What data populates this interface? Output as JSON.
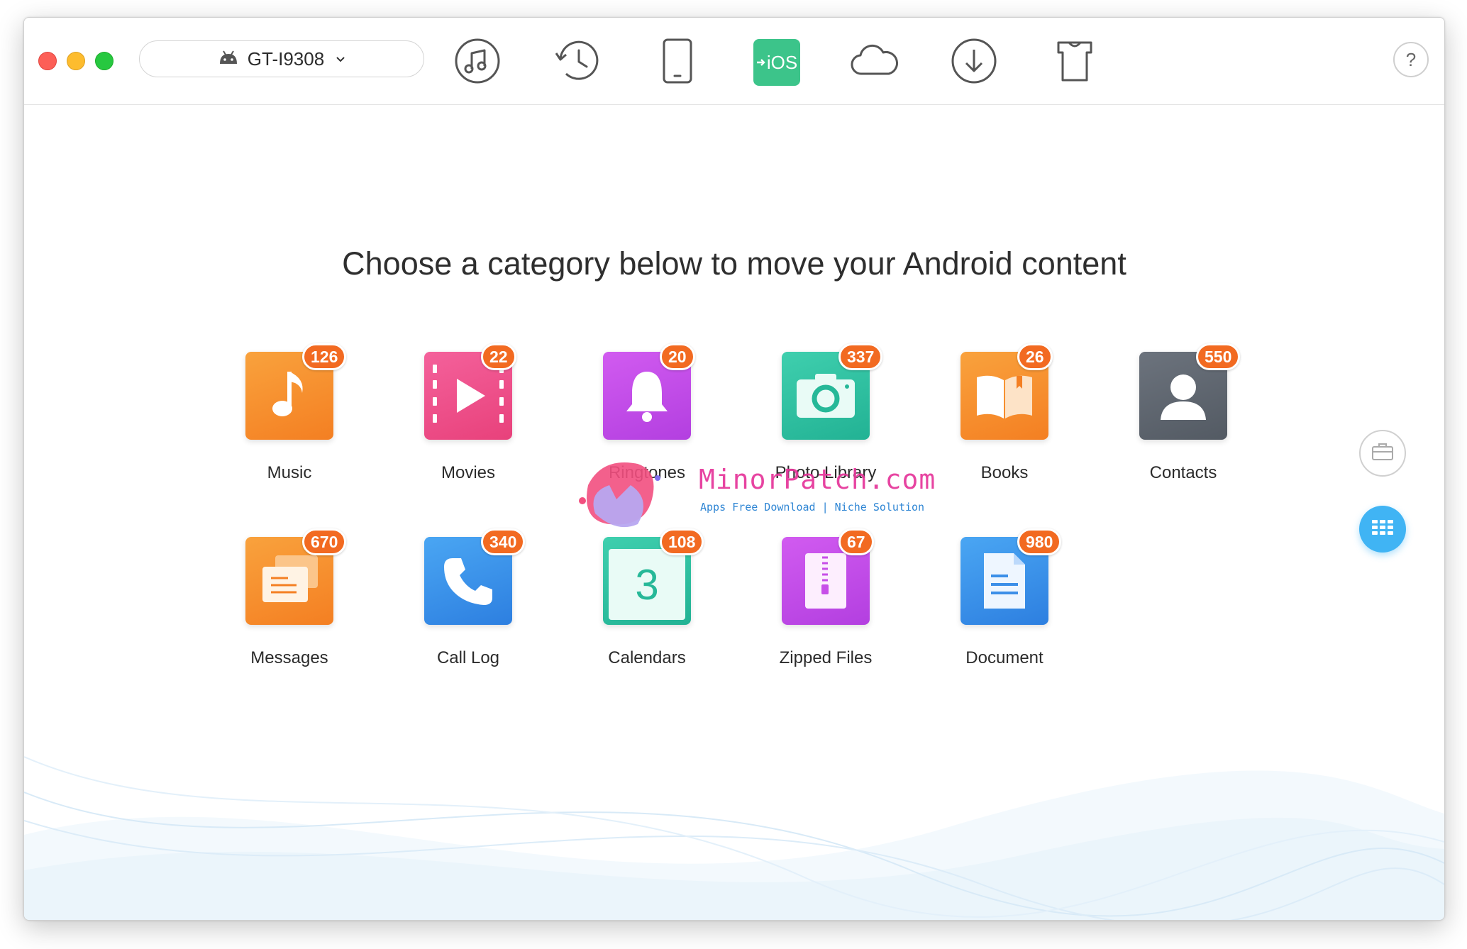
{
  "device": {
    "name": "GT-I9308",
    "icon": "android-icon"
  },
  "toolbar": {
    "items": [
      {
        "name": "music-manager-tool",
        "icon": "music-note-icon"
      },
      {
        "name": "backup-history-tool",
        "icon": "history-clock-icon"
      },
      {
        "name": "device-manager-tool",
        "icon": "phone-icon"
      },
      {
        "name": "android-to-ios-tool",
        "icon": "to-ios-icon",
        "label": "iOS",
        "active": true,
        "color": "#3cc48a"
      },
      {
        "name": "cloud-tool",
        "icon": "cloud-icon"
      },
      {
        "name": "downloader-tool",
        "icon": "download-icon"
      },
      {
        "name": "toolkit-tool",
        "icon": "shirt-icon"
      }
    ],
    "help_label": "?"
  },
  "main": {
    "heading": "Choose a category below to move your Android content",
    "categories": [
      {
        "label": "Music",
        "count": "126",
        "icon": "music-icon",
        "color": "#f7922b"
      },
      {
        "label": "Movies",
        "count": "22",
        "icon": "movies-icon",
        "color": "#ee4f8e"
      },
      {
        "label": "Ringtones",
        "count": "20",
        "icon": "bell-icon",
        "color": "#c74fe8"
      },
      {
        "label": "Photo Library",
        "count": "337",
        "icon": "camera-icon",
        "color": "#2ec3a4"
      },
      {
        "label": "Books",
        "count": "26",
        "icon": "book-icon",
        "color": "#f7922b"
      },
      {
        "label": "Contacts",
        "count": "550",
        "icon": "contact-icon",
        "color": "#5f6670"
      },
      {
        "label": "Messages",
        "count": "670",
        "icon": "message-icon",
        "color": "#f7922b"
      },
      {
        "label": "Call Log",
        "count": "340",
        "icon": "phone-call-icon",
        "color": "#3c8fe8"
      },
      {
        "label": "Calendars",
        "count": "108",
        "icon": "calendar-icon",
        "color": "#2ec3a4",
        "calendar_day": "3"
      },
      {
        "label": "Zipped Files",
        "count": "67",
        "icon": "zip-icon",
        "color": "#c74fe8"
      },
      {
        "label": "Document",
        "count": "980",
        "icon": "document-icon",
        "color": "#3c8fe8"
      }
    ]
  },
  "side": {
    "toolbox_icon": "toolbox-icon",
    "grid_icon": "grid-icon"
  },
  "watermark": {
    "title": "MinorPatch.com",
    "subtitle": "Apps Free Download | Niche Solution"
  }
}
